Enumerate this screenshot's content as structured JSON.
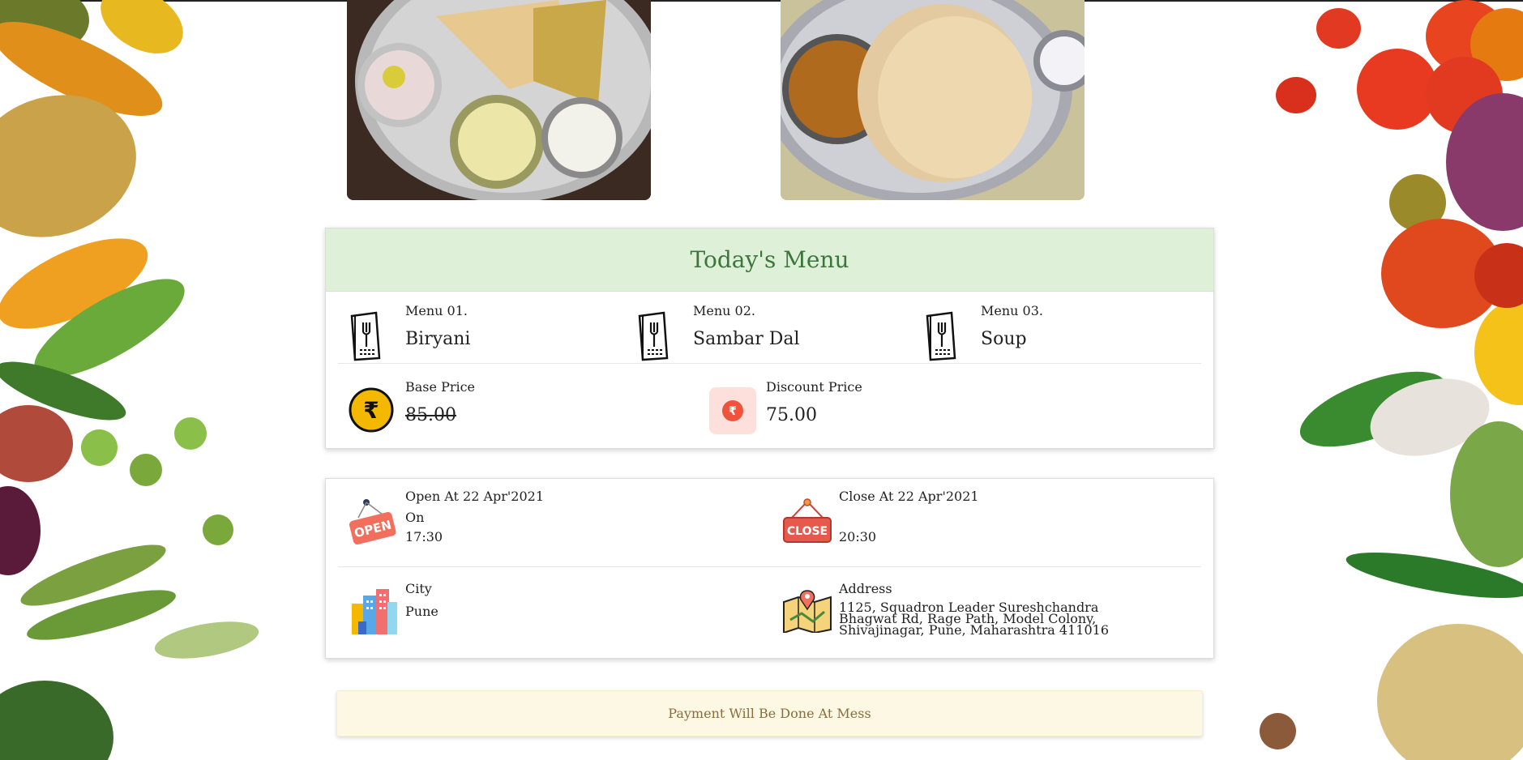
{
  "menu": {
    "title": "Today's Menu",
    "items": [
      {
        "label": "Menu 01.",
        "value": "Biryani"
      },
      {
        "label": "Menu 02.",
        "value": "Sambar Dal"
      },
      {
        "label": "Menu 03.",
        "value": "Soup"
      }
    ],
    "base_price_label": "Base Price",
    "base_price": "85.00",
    "discount_price_label": "Discount Price",
    "discount_price": "75.00",
    "rupee_symbol": "₹"
  },
  "info": {
    "open_label": "Open At 22 Apr'2021",
    "open_on": "On",
    "open_time": "17:30",
    "open_sign": "OPEN",
    "close_label": "Close At 22 Apr'2021",
    "close_time": "20:30",
    "close_sign": "CLOSE",
    "city_label": "City",
    "city": "Pune",
    "address_label": "Address",
    "address": "1125, Squadron Leader Sureshchandra Bhagwat Rd, Rage Path, Model Colony, Shivajinagar, Pune, Maharashtra 411016"
  },
  "payment_note": "Payment Will Be Done At Mess",
  "colors": {
    "menu_header_bg": "#dff0d8",
    "menu_header_text": "#3c763d",
    "payment_bg": "#fcf8e3",
    "payment_text": "#8a6d3b",
    "rupee_gold": "#f5b800",
    "discount_red": "#f0533c"
  }
}
